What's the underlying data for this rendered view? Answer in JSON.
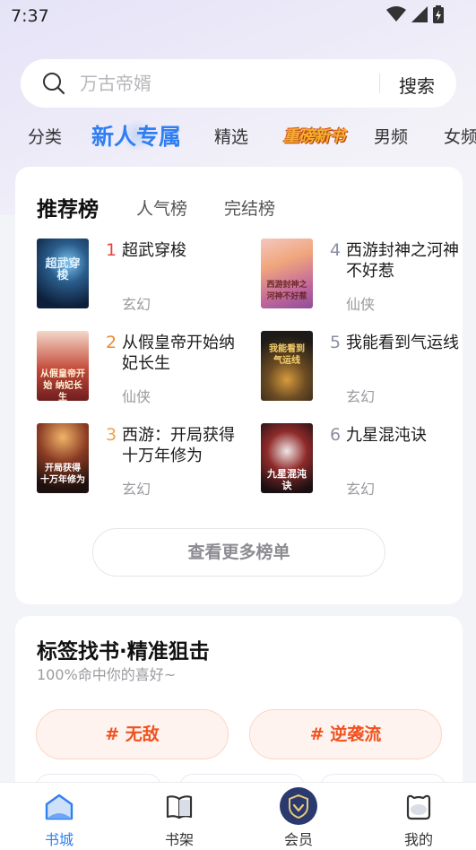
{
  "status": {
    "time": "7:37"
  },
  "search": {
    "placeholder": "万古帝婿",
    "button": "搜索"
  },
  "tabs": [
    "分类",
    "新人专属",
    "精选",
    "重磅新书",
    "男频",
    "女频"
  ],
  "ranking": {
    "tabs": [
      "推荐榜",
      "人气榜",
      "完结榜"
    ],
    "books": [
      {
        "rank": "1",
        "title": "超武穿梭",
        "genre": "玄幻",
        "cover_text": "超武穿梭",
        "rank_color": "#e8423c"
      },
      {
        "rank": "2",
        "title": "从假皇帝开始纳妃长生",
        "genre": "仙侠",
        "cover_text": "从假皇帝开始 纳妃长生",
        "rank_color": "#ef8a2b"
      },
      {
        "rank": "3",
        "title": "西游：开局获得十万年修为",
        "genre": "玄幻",
        "cover_text": "开局获得 十万年修为",
        "rank_color": "#eca24a"
      },
      {
        "rank": "4",
        "title": "西游封神之河神不好惹",
        "genre": "仙侠",
        "cover_text": "西游封神之 河神不好惹",
        "rank_color": "#8a8fa3"
      },
      {
        "rank": "5",
        "title": "我能看到气运线",
        "genre": "玄幻",
        "cover_text": "我能看到 气运线",
        "rank_color": "#8a8fa3"
      },
      {
        "rank": "6",
        "title": "九星混沌诀",
        "genre": "玄幻",
        "cover_text": "九星混沌诀",
        "rank_color": "#8a8fa3"
      }
    ],
    "more_button": "查看更多榜单"
  },
  "tags": {
    "title": "标签找书·精准狙击",
    "subtitle": "100%命中你的喜好~",
    "items": [
      "# 无敌",
      "# 逆袭流"
    ]
  },
  "nav": [
    {
      "label": "书城",
      "icon": "bookstore-icon"
    },
    {
      "label": "书架",
      "icon": "bookshelf-icon"
    },
    {
      "label": "会员",
      "icon": "vip-shield-icon"
    },
    {
      "label": "我的",
      "icon": "profile-icon"
    }
  ],
  "colors": {
    "accent": "#2f7ff2",
    "tag": "#f0521f"
  }
}
